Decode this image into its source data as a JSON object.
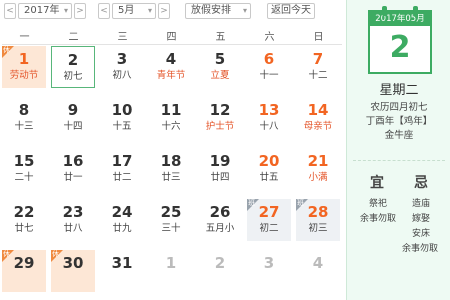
{
  "toolbar": {
    "prev_year": "<",
    "year": "2017年",
    "year_caret": "▾",
    "next_year": ">",
    "prev_month": "<",
    "month": "5月",
    "month_caret": "▾",
    "next_month": ">",
    "holiday": "放假安排",
    "holiday_caret": "▾",
    "today_label": "返回今天"
  },
  "weekdays": [
    "一",
    "二",
    "三",
    "四",
    "五",
    "六",
    "日"
  ],
  "weeks": [
    [
      {
        "day": "1",
        "lunar": "劳动节",
        "red": true,
        "fest": true,
        "holiday": true,
        "tag": "休"
      },
      {
        "day": "2",
        "lunar": "初七",
        "selected": true
      },
      {
        "day": "3",
        "lunar": "初八"
      },
      {
        "day": "4",
        "lunar": "青年节",
        "fest": true
      },
      {
        "day": "5",
        "lunar": "立夏",
        "fest": true
      },
      {
        "day": "6",
        "lunar": "十一",
        "red": true
      },
      {
        "day": "7",
        "lunar": "十二",
        "red": true
      }
    ],
    [
      {
        "day": "8",
        "lunar": "十三"
      },
      {
        "day": "9",
        "lunar": "十四"
      },
      {
        "day": "10",
        "lunar": "十五"
      },
      {
        "day": "11",
        "lunar": "十六"
      },
      {
        "day": "12",
        "lunar": "护士节",
        "fest": true
      },
      {
        "day": "13",
        "lunar": "十八",
        "red": true
      },
      {
        "day": "14",
        "lunar": "母亲节",
        "red": true,
        "fest": true
      }
    ],
    [
      {
        "day": "15",
        "lunar": "二十"
      },
      {
        "day": "16",
        "lunar": "廿一"
      },
      {
        "day": "17",
        "lunar": "廿二"
      },
      {
        "day": "18",
        "lunar": "廿三"
      },
      {
        "day": "19",
        "lunar": "廿四"
      },
      {
        "day": "20",
        "lunar": "廿五",
        "red": true
      },
      {
        "day": "21",
        "lunar": "小满",
        "red": true,
        "fest": true
      }
    ],
    [
      {
        "day": "22",
        "lunar": "廿七"
      },
      {
        "day": "23",
        "lunar": "廿八"
      },
      {
        "day": "24",
        "lunar": "廿九"
      },
      {
        "day": "25",
        "lunar": "三十"
      },
      {
        "day": "26",
        "lunar": "五月小"
      },
      {
        "day": "27",
        "lunar": "初二",
        "red": true,
        "workday": true,
        "tag": "班"
      },
      {
        "day": "28",
        "lunar": "初三",
        "red": true,
        "workday": true,
        "tag": "班"
      }
    ],
    [
      {
        "day": "29",
        "lunar": "",
        "holiday": true,
        "tag": "休"
      },
      {
        "day": "30",
        "lunar": "",
        "holiday": true,
        "tag": "休"
      },
      {
        "day": "31",
        "lunar": ""
      },
      {
        "day": "1",
        "lunar": "",
        "gray": true
      },
      {
        "day": "2",
        "lunar": "",
        "gray": true
      },
      {
        "day": "3",
        "lunar": "",
        "gray": true
      },
      {
        "day": "4",
        "lunar": "",
        "gray": true
      }
    ]
  ],
  "panel": {
    "header": "2017年05月",
    "big_day": "2",
    "weekday": "星期二",
    "lunar_date": "农历四月初七",
    "ganzhi": "丁酉年【鸡年】",
    "zodiac": "金牛座",
    "yi_label": "宜",
    "ji_label": "忌",
    "yi_items": [
      "祭祀",
      "余事勿取"
    ],
    "ji_items": [
      "造庙",
      "嫁娶",
      "安床",
      "余事勿取"
    ]
  },
  "colors": {
    "accent": "#3dab62",
    "holiday_red": "#f26522",
    "holiday_bg": "#fde7d6"
  }
}
